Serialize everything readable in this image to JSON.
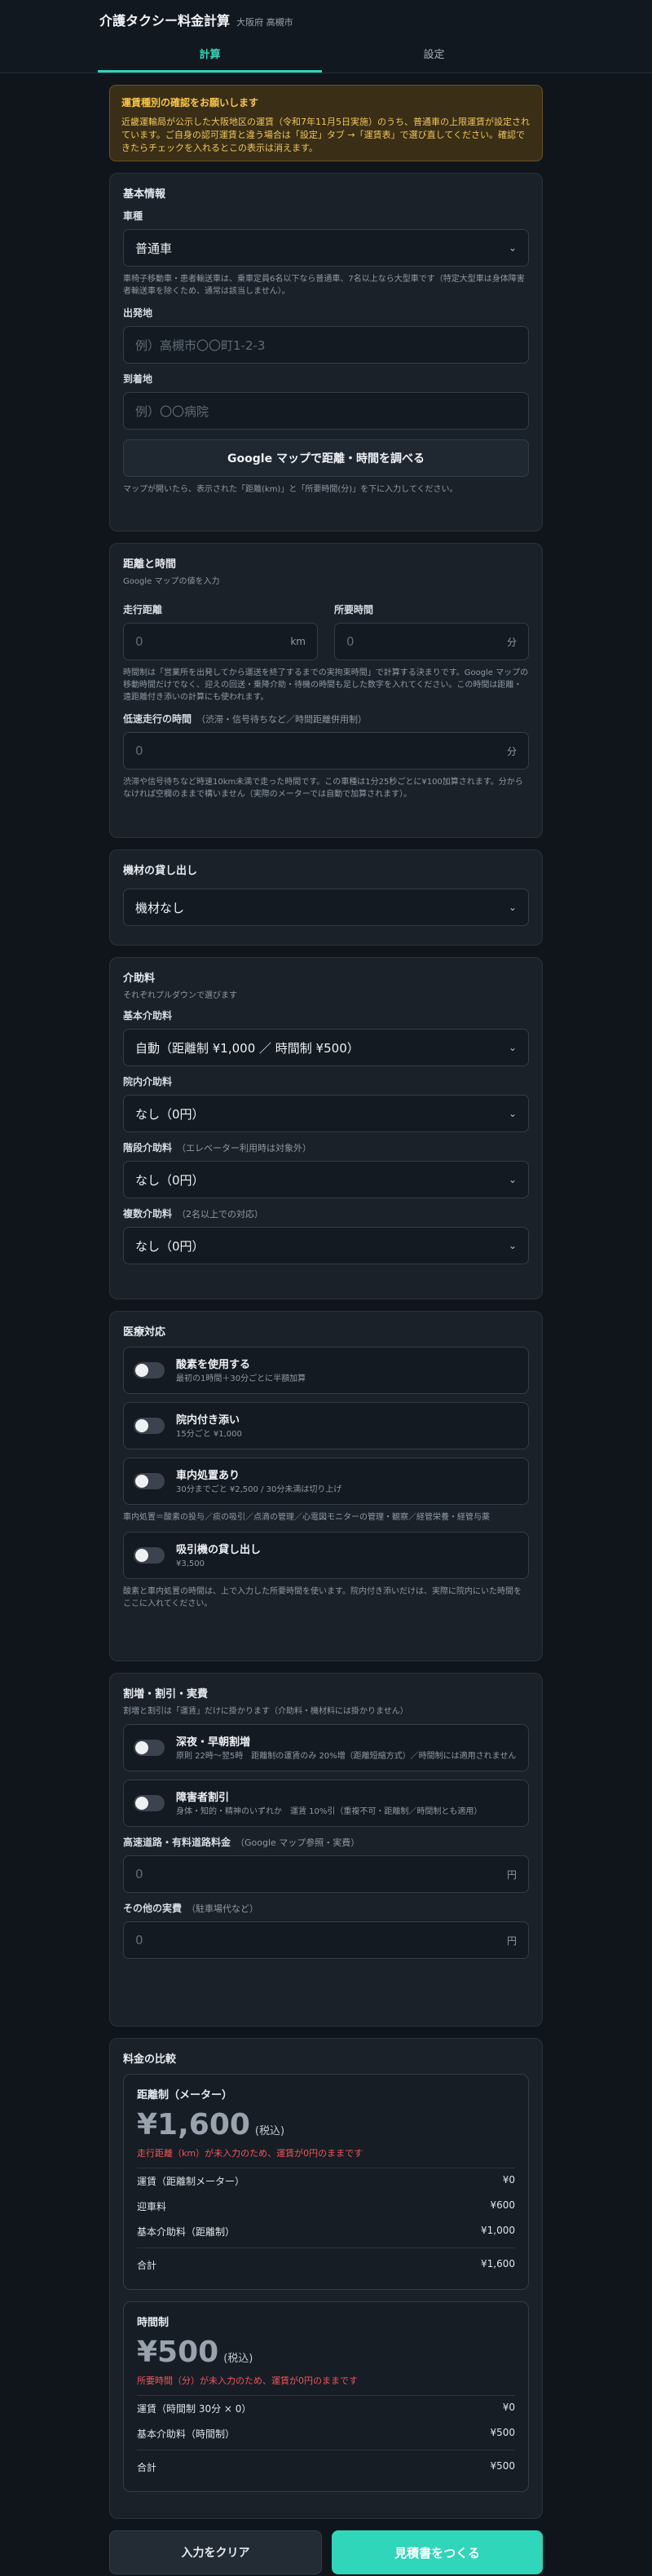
{
  "header": {
    "title": "介護タクシー料金計算",
    "subtitle": "大阪府 高槻市"
  },
  "tabs": [
    {
      "label": "計算"
    },
    {
      "label": "設定"
    }
  ],
  "notice": {
    "title": "運賃種別の確認をお願いします",
    "body": "近畿運輸局が公示した大阪地区の運賃（令和7年11月5日実施）のうち、普通車の上限運賃が設定されています。ご自身の認可運賃と違う場合は「設定」タブ →「運賃表」で選び直してください。確認できたらチェックを入れるとこの表示は消えます。"
  },
  "basic": {
    "title": "基本情報",
    "vehicle_label": "車種",
    "vehicle_value": "普通車",
    "vehicle_help": "車椅子移動車・患者輸送車は、乗車定員6名以下なら普通車、7名以上なら大型車です（特定大型車は身体障害者輸送車を除くため、通常は該当しません）。",
    "origin_label": "出発地",
    "origin_placeholder": "例）高槻市〇〇町1-2-3",
    "dest_label": "到着地",
    "dest_placeholder": "例）〇〇病院",
    "maps_button": "Google マップで距離・時間を調べる",
    "maps_help": "マップが開いたら、表示された「距離(km)」と「所要時間(分)」を下に入力してください。"
  },
  "distance": {
    "title": "距離と時間",
    "subtitle": "Google マップの値を入力",
    "dist_label": "走行距離",
    "dist_placeholder": "0",
    "dist_unit": "km",
    "time_label": "所要時間",
    "time_placeholder": "0",
    "time_unit": "分",
    "help": "時間制は「営業所を出発してから運送を終了するまでの実拘束時間」で計算する決まりです。Google マップの移動時間だけでなく、迎えの回送・乗降介助・待機の時間も足した数字を入れてください。この時間は距離・遠距離付き添いの計算にも使われます。",
    "slow_label": "低速走行の時間",
    "slow_muted": "（渋滞・信号待ちなど／時間距離併用制）",
    "slow_placeholder": "0",
    "slow_unit": "分",
    "slow_help": "渋滞や信号待ちなど時速10km未満で走った時間です。この車種は1分25秒ごとに¥100加算されます。分からなければ空欄のままで構いません（実際のメーターでは自動で加算されます）。"
  },
  "equipment": {
    "title": "機材の貸し出し",
    "value": "機材なし"
  },
  "care": {
    "title": "介助料",
    "subtitle": "それぞれプルダウンで選びます",
    "basic_label": "基本介助料",
    "basic_value": "自動（距離制 ¥1,000 ／ 時間制 ¥500）",
    "hospital_label": "院内介助料",
    "hospital_value": "なし（0円）",
    "stairs_label": "階段介助料",
    "stairs_muted": "（エレベーター利用時は対象外）",
    "stairs_value": "なし（0円）",
    "multi_label": "複数介助料",
    "multi_muted": "（2名以上での対応）",
    "multi_value": "なし（0円）"
  },
  "medical": {
    "title": "医療対応",
    "oxygen_title": "酸素を使用する",
    "oxygen_desc": "最初の1時間＋30分ごとに半額加算",
    "escort_title": "院内付き添い",
    "escort_desc": "15分ごと ¥1,000",
    "ontreat_title": "車内処置あり",
    "ontreat_desc": "30分までごと ¥2,500 / 30分未満は切り上げ",
    "ontreat_help": "車内処置＝酸素の投与／痰の吸引／点滴の管理／心電図モニターの管理・観察／経管栄養・経管与薬",
    "suction_title": "吸引機の貸し出し",
    "suction_desc": "¥3,500",
    "help": "酸素と車内処置の時間は、上で入力した所要時間を使います。院内付き添いだけは、実際に院内にいた時間をここに入れてください。"
  },
  "surcharge": {
    "title": "割増・割引・実費",
    "subtitle": "割増と割引は「運賃」だけに掛かります（介助料・機材料には掛かりません）",
    "night_title": "深夜・早朝割増",
    "night_desc": "原則 22時〜翌5時　距離制の運賃のみ 20%増（距離短縮方式）／時間制には適用されません",
    "disabled_title": "障害者割引",
    "disabled_desc": "身体・知的・精神のいずれか　運賃 10%引（重複不可・距離制／時間制とも適用）",
    "toll_label": "高速道路・有料道路料金",
    "toll_muted": "（Google マップ参照・実費）",
    "toll_placeholder": "0",
    "toll_unit": "円",
    "other_label": "その他の実費",
    "other_muted": "（駐車場代など）",
    "other_placeholder": "0",
    "other_unit": "円"
  },
  "compare": {
    "title": "料金の比較",
    "distance": {
      "title": "距離制（メーター）",
      "amount": "¥1,600",
      "tax": "(税込)",
      "error": "走行距離（km）が未入力のため、運賃が0円のままです",
      "rows": [
        {
          "label": "運賃（距離制メーター）",
          "value": "¥0"
        },
        {
          "label": "迎車料",
          "value": "¥600"
        },
        {
          "label": "基本介助料（距離制）",
          "value": "¥1,000"
        }
      ],
      "total_label": "合計",
      "total_value": "¥1,600"
    },
    "time": {
      "title": "時間制",
      "amount": "¥500",
      "tax": "(税込)",
      "error": "所要時間（分）が未入力のため、運賃が0円のままです",
      "rows": [
        {
          "label": "運賃（時間制 30分 × 0）",
          "value": "¥0"
        },
        {
          "label": "基本介助料（時間制）",
          "value": "¥500"
        }
      ],
      "total_label": "合計",
      "total_value": "¥500"
    }
  },
  "footer": {
    "clear": "入力をクリア",
    "estimate": "見積書をつくる"
  },
  "colors": {
    "accent": "#2fd6b9",
    "warning": "#f7c64a",
    "error": "#f0555a"
  }
}
